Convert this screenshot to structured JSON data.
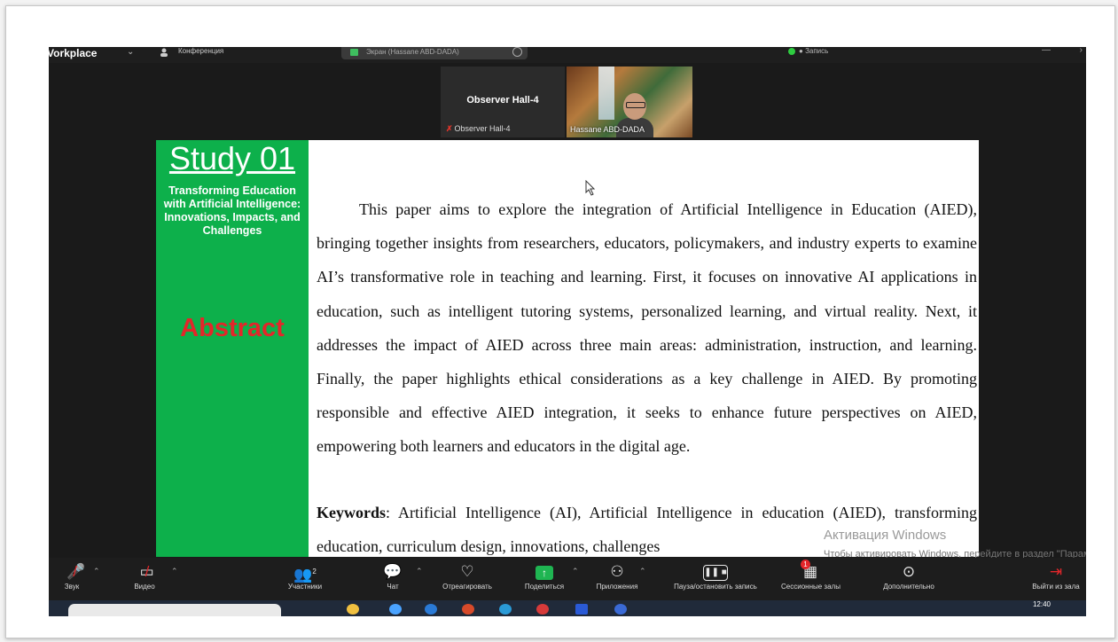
{
  "topbar": {
    "app_title": "Vorkplace",
    "conference_label": "Конференция",
    "screen_share_label": "Экран (Hassane ABD-DADA)",
    "right_status": "Запись"
  },
  "participants_tiles": [
    {
      "name": "Observer Hall-4",
      "footer": "Observer Hall-4",
      "muted": true
    },
    {
      "footer": "Hassane ABD-DADA"
    }
  ],
  "slide": {
    "study_title": "Study 01",
    "paper_title": "Transforming Education with Artificial Intelligence: Innovations, Impacts, and Challenges",
    "section_label": "Abstract",
    "abstract_text": "This paper aims to explore the integration of Artificial Intelligence in Education (AIED), bringing together insights from researchers, educators, policymakers, and industry experts to examine AI’s transformative role in teaching and learning. First, it focuses on innovative AI applications in education, such as intelligent tutoring systems, personalized learning, and virtual reality. Next, it addresses the impact of AIED across three main areas: administration, instruction, and learning. Finally, the paper highlights ethical considerations as a key challenge in AIED. By promoting responsible and effective AIED integration, it seeks to enhance future perspectives on AIED, empowering both learners and educators in the digital age.",
    "keywords_label": "Keywords",
    "keywords_text": ": Artificial Intelligence (AI), Artificial Intelligence in education (AIED), transforming education, curriculum design, innovations, challenges"
  },
  "windows_activation": {
    "title": "Активация Windows",
    "subtitle": "Чтобы активировать Windows, перейдите в раздел \"Параметры\"."
  },
  "toolbar": {
    "audio": "Звук",
    "video": "Видео",
    "participants": "Участники",
    "participants_count": "2",
    "chat": "Чат",
    "react": "Отреагировать",
    "share": "Поделиться",
    "apps": "Приложения",
    "pause_record": "Пауза/остановить запись",
    "breakout": "Сессионные залы",
    "breakout_badge": "1",
    "more": "Дополнительно",
    "leave": "Выйти из зала"
  },
  "taskbar": {
    "time": "12:40"
  }
}
